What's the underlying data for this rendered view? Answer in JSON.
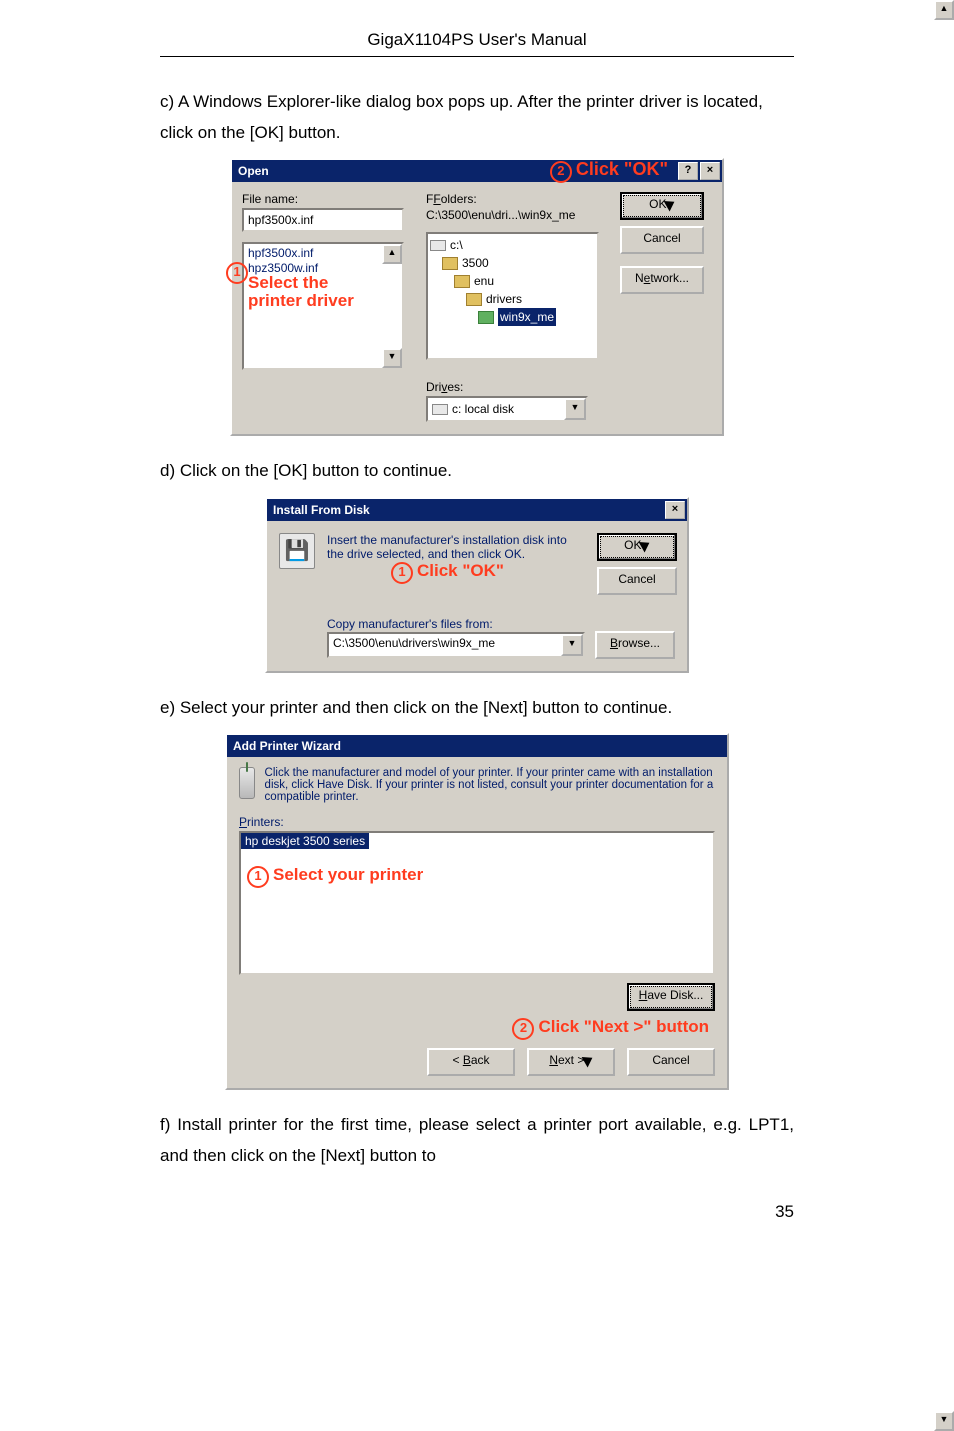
{
  "header": {
    "title": "GigaX1104PS User's Manual"
  },
  "para_c": "c) A Windows Explorer-like dialog box pops up. After the printer driver is located, click on the [OK] button.",
  "para_d": "d) Click on the [OK] button to continue.",
  "para_e": "e) Select your printer and then click on the [Next] button to continue.",
  "para_f": "f) Install printer for the first time, please select a printer port available, e.g. LPT1, and then click on the [Next] button to",
  "page_number": "35",
  "open": {
    "title": "Open",
    "annot2_num": "2",
    "annot2_text": "Click \"OK\"",
    "help_btn": "?",
    "close_btn": "×",
    "file_name_label": "File name:",
    "file_name_value": "hpf3500x.inf",
    "folders_label": "Folders:",
    "folders_path": "C:\\3500\\enu\\dri...\\win9x_me",
    "list_items": [
      "hpf3500x.inf",
      "hpz3500w.inf"
    ],
    "annot1_num": "1",
    "annot1_line1": "Select the",
    "annot1_line2": "printer driver",
    "tree": {
      "n0": "c:\\",
      "n1": "3500",
      "n2": "enu",
      "n3": "drivers",
      "n4": "win9x_me"
    },
    "ok": "OK",
    "cancel": "Cancel",
    "network": "Network...",
    "drives_label": "Drives:",
    "drives_value": "c: local disk"
  },
  "ifd": {
    "title": "Install From Disk",
    "close_btn": "×",
    "msg_line1": "Insert the manufacturer's installation disk into",
    "msg_line2": "the drive selected, and then click OK.",
    "annot_num": "1",
    "annot_text": "Click \"OK\"",
    "ok": "OK",
    "cancel": "Cancel",
    "copy_label": "Copy manufacturer's files from:",
    "path": "C:\\3500\\enu\\drivers\\win9x_me",
    "browse": "Browse..."
  },
  "apw": {
    "title": "Add Printer Wizard",
    "msg": "Click the manufacturer and model of your printer. If your printer came with an installation disk, click Have Disk. If your printer is not listed, consult your printer documentation for a compatible printer.",
    "printers_label": "Printers:",
    "selected": "hp deskjet 3500 series",
    "annot1_num": "1",
    "annot1_text": "Select your printer",
    "have_disk": "Have Disk...",
    "annot2_num": "2",
    "annot2_text": "Click \"Next >\" button",
    "back": "< Back",
    "next": "Next >",
    "cancel": "Cancel"
  }
}
